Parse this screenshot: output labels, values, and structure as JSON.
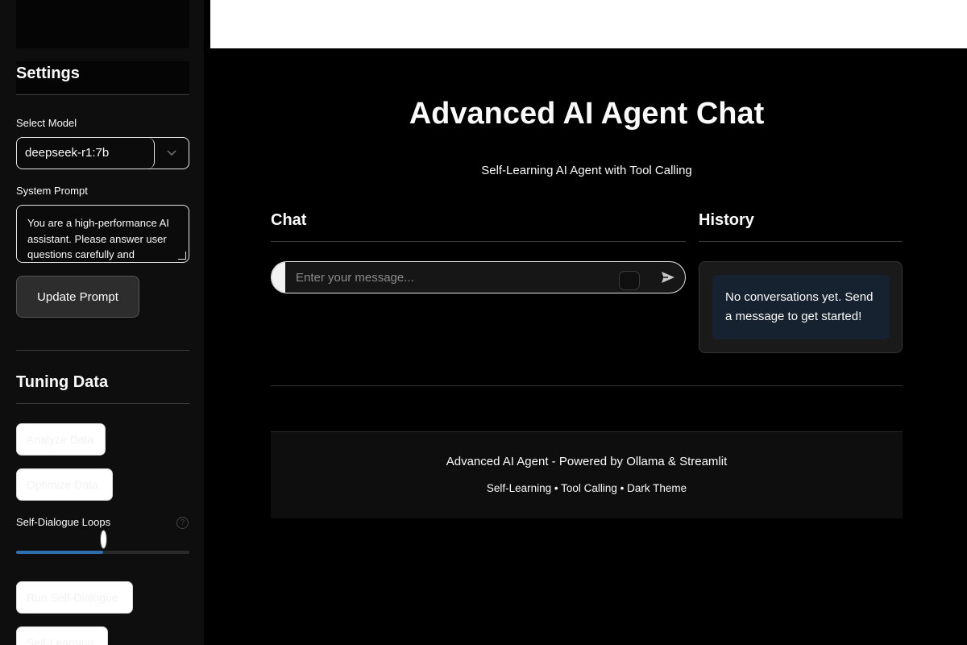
{
  "sidebar": {
    "settings_heading": "Settings",
    "select_model_label": "Select Model",
    "selected_model": "deepseek-r1:7b",
    "system_prompt_label": "System Prompt",
    "system_prompt_text": "You are a high-performance AI assistant. Please answer user questions carefully and",
    "update_prompt_button": "Update Prompt",
    "tuning_heading": "Tuning Data",
    "analyze_button": "Analyze Data",
    "optimize_button": "Optimize Data",
    "loops_label": "Self-Dialogue Loops",
    "loops_help": "?",
    "loops_slider_fraction": 0.5,
    "run_dialogue_button": "Run Self-Dialogue",
    "self_learning_button": "Self-Learning"
  },
  "main": {
    "title": "Advanced AI Agent Chat",
    "subtitle": "Self-Learning AI Agent with Tool Calling",
    "chat_heading": "Chat",
    "history_heading": "History",
    "chat_placeholder": "Enter your message...",
    "history_empty": "No conversations yet. Send a message to get started!",
    "footer_line1": "Advanced AI Agent - Powered by Ollama & Streamlit",
    "footer_line2": "Self-Learning • Tool Calling • Dark Theme"
  },
  "colors": {
    "background": "#000000",
    "sidebar": "#0e0e0e",
    "slider_accent": "#2f6fb0",
    "history_message_bg": "#172230"
  },
  "icons": {
    "send": "send-arrow-icon",
    "dropdown": "chevron-down-icon",
    "help": "help-circle-icon"
  }
}
